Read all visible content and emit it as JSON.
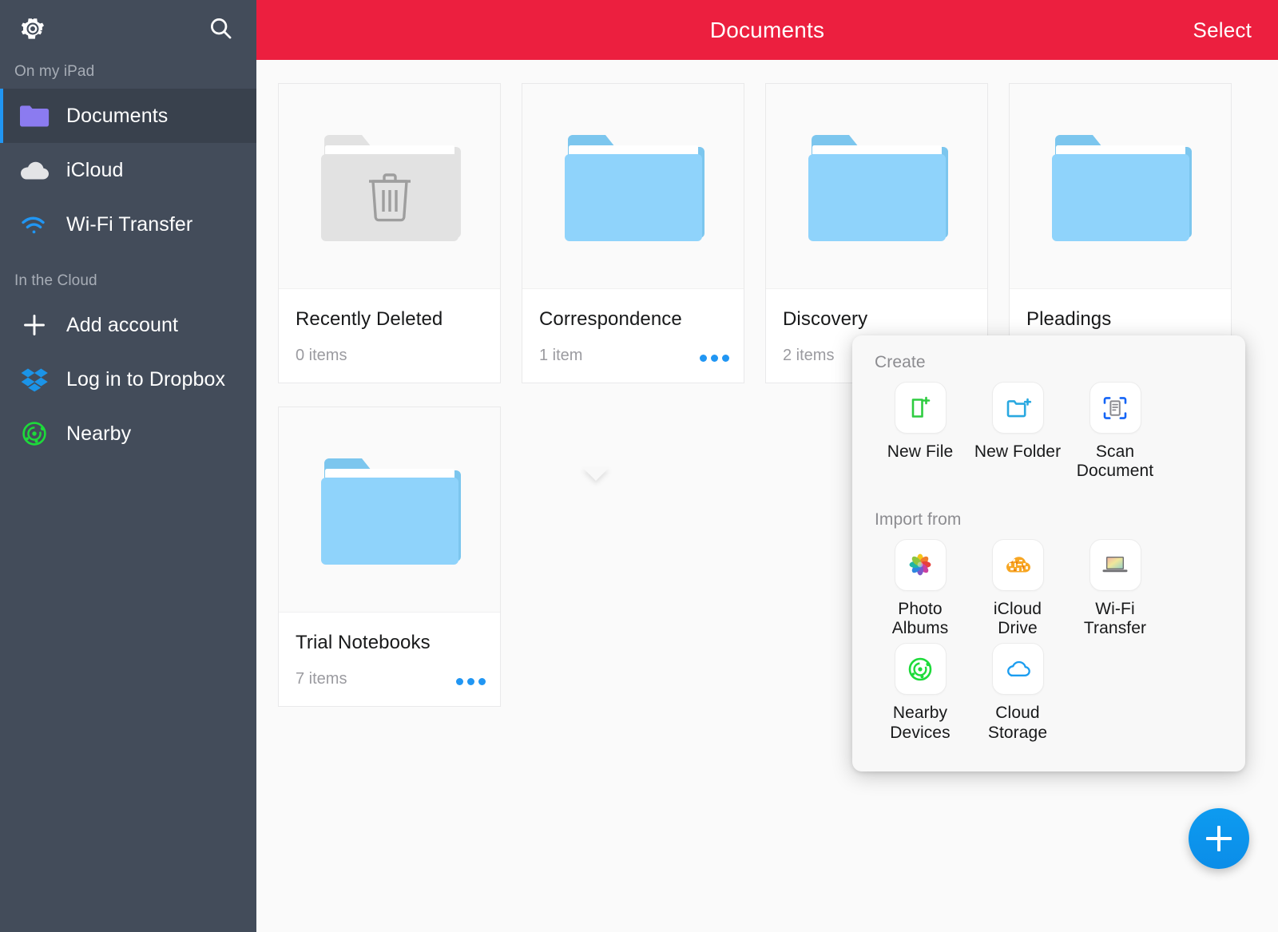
{
  "sidebar": {
    "gear_icon": "gear-icon",
    "search_icon": "search-icon",
    "sections": [
      {
        "label": "On my iPad",
        "items": [
          {
            "label": "Documents",
            "icon": "folder-icon",
            "active": true
          },
          {
            "label": "iCloud",
            "icon": "cloud-icon",
            "active": false
          },
          {
            "label": "Wi-Fi Transfer",
            "icon": "wifi-icon",
            "active": false
          }
        ]
      },
      {
        "label": "In the Cloud",
        "items": [
          {
            "label": "Add account",
            "icon": "plus-icon",
            "active": false
          },
          {
            "label": "Log in to Dropbox",
            "icon": "dropbox-icon",
            "active": false
          },
          {
            "label": "Nearby",
            "icon": "nearby-radar-icon",
            "active": false
          }
        ]
      }
    ]
  },
  "titlebar": {
    "title": "Documents",
    "select_label": "Select",
    "background_color": "#ec1f3f"
  },
  "grid": {
    "cards": [
      {
        "name": "Recently Deleted",
        "meta": "0 items",
        "icon": "trash-folder-icon",
        "has_more": false
      },
      {
        "name": "Correspondence",
        "meta": "1 item",
        "icon": "blue-folder-icon",
        "has_more": true
      },
      {
        "name": "Discovery",
        "meta": "2 items",
        "icon": "blue-folder-icon",
        "has_more": true
      },
      {
        "name": "Pleadings",
        "meta": "",
        "icon": "blue-folder-icon",
        "has_more": false
      },
      {
        "name": "Trial Notebooks",
        "meta": "7 items",
        "icon": "blue-folder-icon",
        "has_more": true
      }
    ]
  },
  "popover": {
    "create": {
      "label": "Create",
      "items": [
        {
          "label": "New File",
          "icon": "new-file-icon",
          "color": "#2ecc40"
        },
        {
          "label": "New Folder",
          "icon": "new-folder-icon",
          "color": "#29a8e0"
        },
        {
          "label": "Scan\nDocument",
          "icon": "scan-document-icon",
          "color": "#1464f6"
        }
      ]
    },
    "import": {
      "label": "Import from",
      "items": [
        {
          "label": "Photo\nAlbums",
          "icon": "photos-icon",
          "color": "#f6a623"
        },
        {
          "label": "iCloud\nDrive",
          "icon": "icloud-drive-icon",
          "color": "#f5a524"
        },
        {
          "label": "Wi-Fi\nTransfer",
          "icon": "laptop-icon",
          "color": "#8b8b8b"
        },
        {
          "label": "Nearby\nDevices",
          "icon": "nearby-radar-icon",
          "color": "#1ddb3a"
        },
        {
          "label": "Cloud\nStorage",
          "icon": "cloud-outline-icon",
          "color": "#1b9df0"
        }
      ]
    }
  },
  "fab": {
    "icon": "plus-icon",
    "label": "Add",
    "color": "#0b8de8"
  }
}
